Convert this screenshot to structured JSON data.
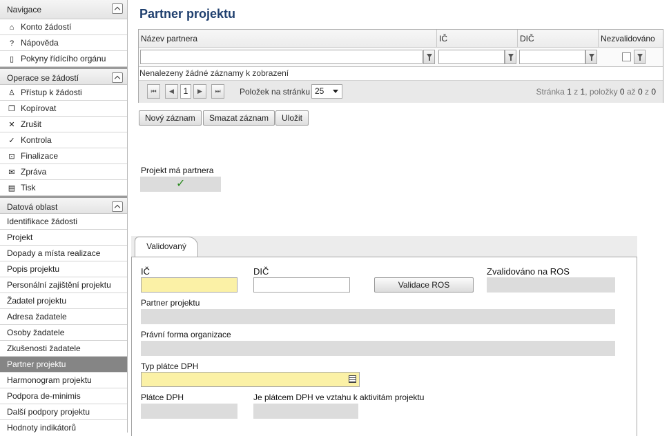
{
  "sidebar": {
    "sections": [
      {
        "title": "Navigace",
        "items": [
          {
            "label": "Konto žádostí",
            "icon": "home-icon",
            "glyph": "⌂"
          },
          {
            "label": "Nápověda",
            "icon": "help-icon",
            "glyph": "?"
          },
          {
            "label": "Pokyny řídícího orgánu",
            "icon": "book-icon",
            "glyph": "🕮"
          }
        ]
      },
      {
        "title": "Operace se žádostí",
        "items": [
          {
            "label": "Přístup k žádosti",
            "icon": "user-icon",
            "glyph": "♙"
          },
          {
            "label": "Kopírovat",
            "icon": "copy-icon",
            "glyph": "⧉"
          },
          {
            "label": "Zrušit",
            "icon": "cancel-icon",
            "glyph": "✕"
          },
          {
            "label": "Kontrola",
            "icon": "check-icon",
            "glyph": "✓"
          },
          {
            "label": "Finalizace",
            "icon": "lock-icon",
            "glyph": "🔒"
          },
          {
            "label": "Zpráva",
            "icon": "envelope-icon",
            "glyph": "✉"
          },
          {
            "label": "Tisk",
            "icon": "print-icon",
            "glyph": "▤"
          }
        ]
      },
      {
        "title": "Datová oblast",
        "items": [
          {
            "label": "Identifikace žádosti"
          },
          {
            "label": "Projekt"
          },
          {
            "label": "Dopady a místa realizace"
          },
          {
            "label": "Popis projektu"
          },
          {
            "label": "Personální zajištění projektu"
          },
          {
            "label": "Žadatel projektu"
          },
          {
            "label": "Adresa žadatele"
          },
          {
            "label": "Osoby žadatele"
          },
          {
            "label": "Zkušenosti žadatele"
          },
          {
            "label": "Partner projektu",
            "active": true
          },
          {
            "label": "Harmonogram projektu"
          },
          {
            "label": "Podpora de-minimis"
          },
          {
            "label": "Další podpory projektu"
          },
          {
            "label": "Hodnoty indikátorů"
          }
        ]
      }
    ]
  },
  "main": {
    "title": "Partner projektu",
    "grid": {
      "columns": [
        "Název partnera",
        "IČ",
        "DIČ",
        "Nezvalidováno"
      ],
      "empty_message": "Nenalezeny žádné záznamy k zobrazení",
      "pager": {
        "page": "1",
        "page_size_label": "Položek na stránku",
        "page_size": "25",
        "info_prefix": "Stránka ",
        "info_page": "1",
        "info_mid1": " z ",
        "info_pages": "1",
        "info_mid2": ", položky ",
        "info_from": "0",
        "info_mid3": " až ",
        "info_to": "0",
        "info_mid4": " z ",
        "info_total": "0"
      }
    },
    "buttons": {
      "new": "Nový záznam",
      "delete": "Smazat záznam",
      "save": "Uložit"
    },
    "has_partner": {
      "label": "Projekt má partnera",
      "checked": "✓"
    },
    "tab": {
      "label": "Validovaný"
    },
    "form": {
      "ic_label": "IČ",
      "dic_label": "DIČ",
      "validate_button": "Validace ROS",
      "validated_label": "Zvalidováno na ROS",
      "partner_label": "Partner projektu",
      "legal_form_label": "Právní forma organizace",
      "vat_type_label": "Typ plátce DPH",
      "vat_payer_label": "Plátce DPH",
      "vat_activity_label": "Je plátcem DPH ve vztahu k aktivitám projektu"
    },
    "colors": {
      "title": "#1f3f6e",
      "required_field": "#fbf1a6",
      "readonly_field": "#dcdcdc",
      "active_nav": "#858585"
    }
  }
}
